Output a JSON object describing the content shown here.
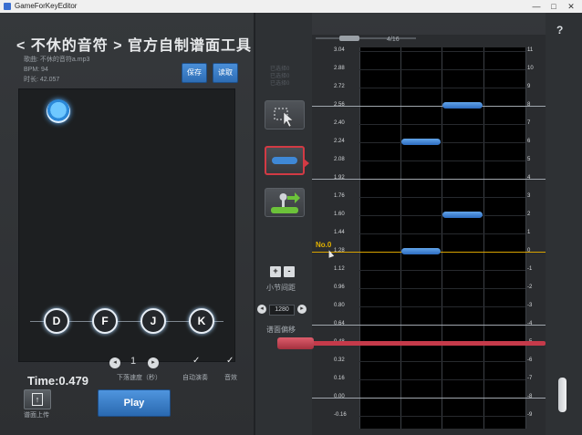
{
  "window": {
    "title": "GameForKeyEditor",
    "minimize": "—",
    "maximize": "□",
    "close": "✕"
  },
  "header": {
    "title": "< 不休的音符 > 官方自制谱面工具"
  },
  "song": {
    "label_song": "歌曲:",
    "song_name": "不休的音符a.mp3",
    "bpm": "BPM: 94",
    "duration": "时长: 42.057"
  },
  "actions": {
    "save": "保存",
    "load": "读取"
  },
  "keys": [
    "D",
    "F",
    "J",
    "K"
  ],
  "playback": {
    "time": "Time:0.479",
    "speed_value": "1",
    "speed_label": "下落速度（秒）",
    "auto_play_label": "自动演奏",
    "sfx_label": "音效",
    "check_mark": "✓",
    "upload_label": "谱面上传",
    "play": "Play"
  },
  "tools": {
    "faint_text": [
      "已选择0",
      "已选择0",
      "已选择0"
    ],
    "spacing_label": "小节间距",
    "spacing_value": "1280",
    "offset_label": "谱面偏移",
    "plus": "+",
    "minus": "-",
    "left_arrow": "◂",
    "right_arrow": "▸",
    "tool_icons": [
      "select-box-icon",
      "tap-note-icon",
      "hold-note-icon"
    ]
  },
  "page": {
    "current": "4/16"
  },
  "grid": {
    "left_labels": [
      "3.04",
      "2.88",
      "2.72",
      "2.56",
      "2.40",
      "2.24",
      "2.08",
      "1.92",
      "1.76",
      "1.60",
      "1.44",
      "1.28",
      "1.12",
      "0.96",
      "0.80",
      "0.64",
      "0.48",
      "0.32",
      "0.16",
      "0.00",
      "-0.16"
    ],
    "right_labels": [
      "11",
      "10",
      "9",
      "8",
      "7",
      "6",
      "5",
      "4",
      "3",
      "2",
      "1",
      "0",
      "-1",
      "-2",
      "-3",
      "-4",
      "-5",
      "-6",
      "-7",
      "-8",
      "-9"
    ],
    "marker": "No.0",
    "notes": [
      {
        "lane": 2,
        "time": 2.56
      },
      {
        "lane": 1,
        "time": 2.24
      },
      {
        "lane": 2,
        "time": 1.6
      },
      {
        "lane": 1,
        "time": 1.28
      }
    ]
  },
  "help": "?",
  "colors": {
    "accent_blue": "#2e6db5",
    "active_tool_border": "#d23a44",
    "current_line": "#d8a200",
    "offset_line": "#c53a4a"
  }
}
